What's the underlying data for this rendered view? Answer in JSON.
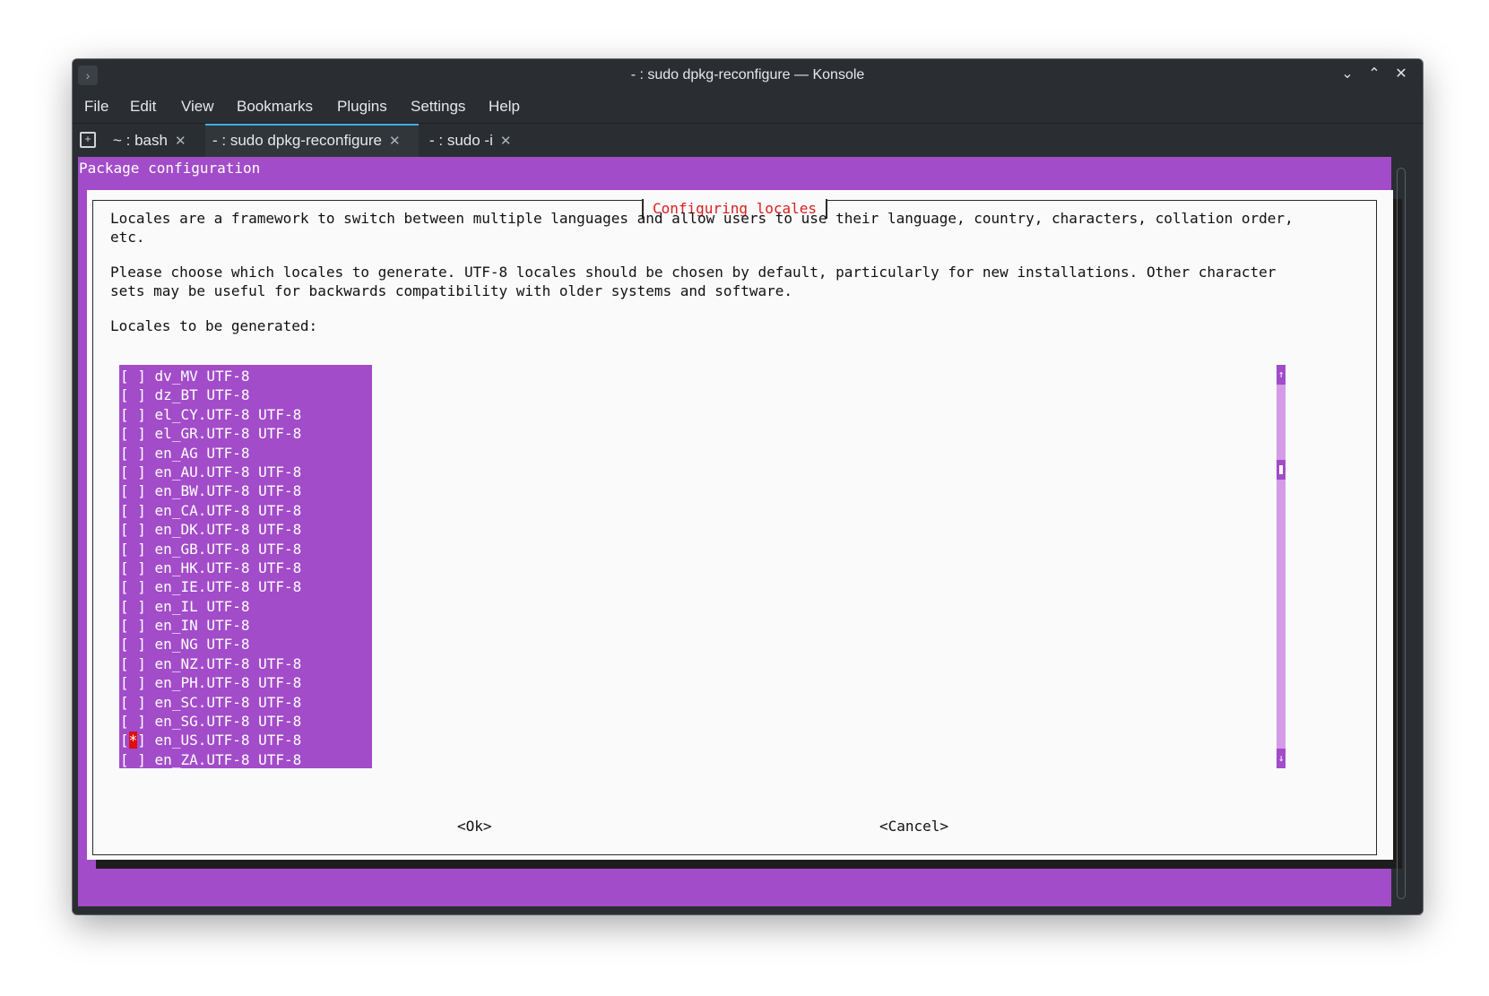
{
  "window": {
    "title": "- : sudo dpkg-reconfigure — Konsole",
    "controls": {
      "minimize": "⌄",
      "maximize": "⌃",
      "close": "✕"
    }
  },
  "menubar": [
    "File",
    "Edit",
    "View",
    "Bookmarks",
    "Plugins",
    "Settings",
    "Help"
  ],
  "tabs": [
    {
      "label": "~ : bash",
      "active": false
    },
    {
      "label": "- : sudo dpkg-reconfigure",
      "active": true
    },
    {
      "label": "- : sudo -i",
      "active": false
    }
  ],
  "terminal": {
    "header": "Package configuration",
    "dialog_title": "Configuring locales",
    "paragraph1": [
      "Locales are a framework to switch between multiple languages and allow users to use their language, country, characters, collation order,",
      "etc."
    ],
    "paragraph2": [
      "Please choose which locales to generate. UTF-8 locales should be chosen by default, particularly for new installations. Other character",
      "sets may be useful for backwards compatibility with older systems and software."
    ],
    "list_label": "Locales to be generated:",
    "locales": [
      {
        "name": "dv_MV UTF-8",
        "checked": false
      },
      {
        "name": "dz_BT UTF-8",
        "checked": false
      },
      {
        "name": "el_CY.UTF-8 UTF-8",
        "checked": false
      },
      {
        "name": "el_GR.UTF-8 UTF-8",
        "checked": false
      },
      {
        "name": "en_AG UTF-8",
        "checked": false
      },
      {
        "name": "en_AU.UTF-8 UTF-8",
        "checked": false
      },
      {
        "name": "en_BW.UTF-8 UTF-8",
        "checked": false
      },
      {
        "name": "en_CA.UTF-8 UTF-8",
        "checked": false
      },
      {
        "name": "en_DK.UTF-8 UTF-8",
        "checked": false
      },
      {
        "name": "en_GB.UTF-8 UTF-8",
        "checked": false
      },
      {
        "name": "en_HK.UTF-8 UTF-8",
        "checked": false
      },
      {
        "name": "en_IE.UTF-8 UTF-8",
        "checked": false
      },
      {
        "name": "en_IL UTF-8",
        "checked": false
      },
      {
        "name": "en_IN UTF-8",
        "checked": false
      },
      {
        "name": "en_NG UTF-8",
        "checked": false
      },
      {
        "name": "en_NZ.UTF-8 UTF-8",
        "checked": false
      },
      {
        "name": "en_PH.UTF-8 UTF-8",
        "checked": false
      },
      {
        "name": "en_SC.UTF-8 UTF-8",
        "checked": false
      },
      {
        "name": "en_SG.UTF-8 UTF-8",
        "checked": false
      },
      {
        "name": "en_US.UTF-8 UTF-8",
        "checked": true
      },
      {
        "name": "en_ZA.UTF-8 UTF-8",
        "checked": false
      }
    ],
    "scroll_arrows": {
      "up": "↑",
      "down": "↓"
    },
    "ok_button": "<Ok>",
    "cancel_button": "<Cancel>"
  },
  "colors": {
    "terminal_bg": "#a24cc9",
    "dialog_bg": "#fafafa",
    "dialog_title": "#d81e1e",
    "checked_mark": "#e00e0e",
    "window_chrome": "#2a2e32"
  }
}
